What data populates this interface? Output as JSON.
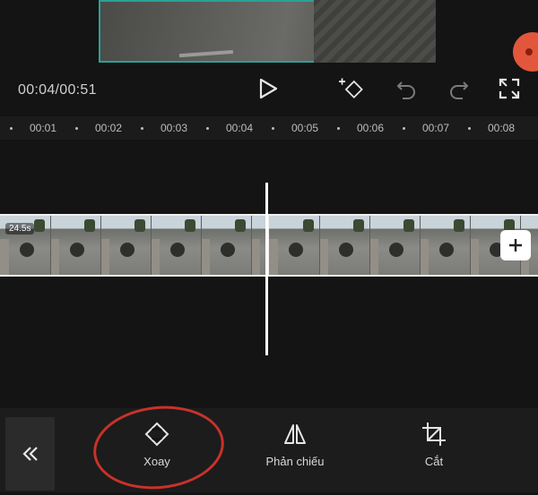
{
  "player": {
    "time_display": "00:04/00:51"
  },
  "ruler": {
    "ticks": [
      "00:01",
      "00:02",
      "00:03",
      "00:04",
      "00:05",
      "00:06",
      "00:07",
      "00:08"
    ]
  },
  "clip": {
    "duration_label": "24.5s"
  },
  "toolbar_bottom": {
    "rotate_label": "Xoay",
    "mirror_label": "Phản chiếu",
    "crop_label": "Cắt"
  },
  "colors": {
    "annotation_circle": "#c8322a",
    "record_button": "#e2573b",
    "background": "#141414"
  },
  "icons": [
    "play-icon",
    "keyframe-add-icon",
    "undo-icon",
    "redo-icon",
    "fullscreen-icon",
    "add-icon",
    "double-chevron-left-icon",
    "rotate-icon",
    "mirror-icon",
    "crop-icon"
  ]
}
